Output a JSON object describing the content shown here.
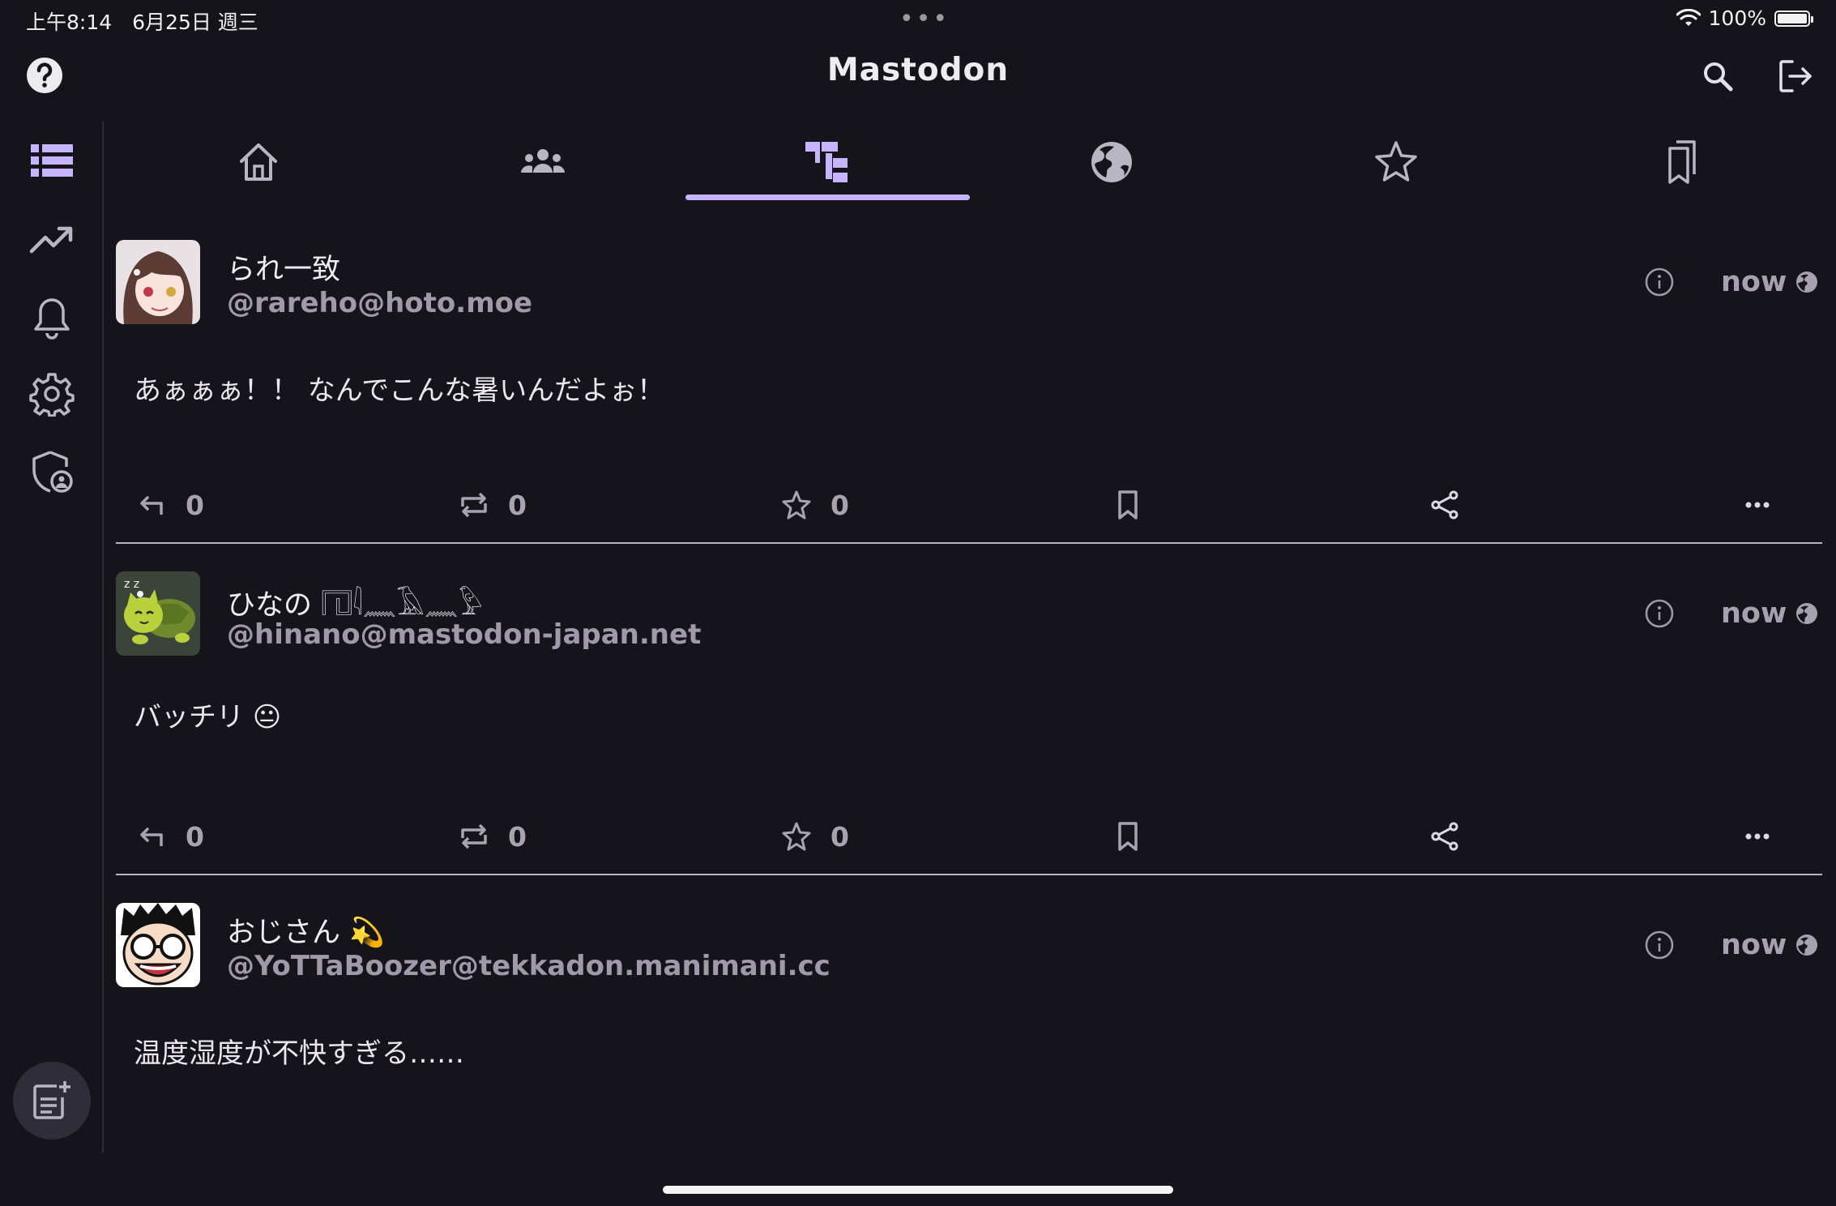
{
  "status_bar": {
    "time_date": "上午8:14　6月25日 週三",
    "dots": "•••",
    "battery_text": "100%"
  },
  "header": {
    "title": "Mastodon"
  },
  "tabs": [
    {
      "name": "home",
      "icon": "home-icon",
      "selected": false
    },
    {
      "name": "local",
      "icon": "people-icon",
      "selected": false
    },
    {
      "name": "federated-tree",
      "icon": "tree-icon",
      "selected": true
    },
    {
      "name": "public",
      "icon": "globe-icon",
      "selected": false
    },
    {
      "name": "favourites",
      "icon": "star-icon",
      "selected": false
    },
    {
      "name": "bookmarks",
      "icon": "bookmarks-icon",
      "selected": false
    }
  ],
  "side_rail": [
    "timeline-list-icon",
    "trending-icon",
    "bell-icon",
    "gear-icon",
    "shield-user-icon"
  ],
  "colors": {
    "background": "#15141a",
    "accent": "#c7b4ff",
    "muted_text": "#9e9aa9",
    "divider": "#b8b5c2"
  },
  "posts": [
    {
      "display_name": "られ一致",
      "handle": "@rareho@hoto.moe",
      "time": "now",
      "body": "あぁぁぁ！！ なんでこんな暑いんだよぉ！",
      "replies": "0",
      "boosts": "0",
      "favourites": "0"
    },
    {
      "display_name": "ひなの 𓉔𓇋𓈖𓄿𓈖𓅱",
      "handle": "@hinano@mastodon-japan.net",
      "time": "now",
      "body": "バッチリ 😐",
      "replies": "0",
      "boosts": "0",
      "favourites": "0"
    },
    {
      "display_name": "おじさん 💫",
      "handle": "@YoTTaBoozer@tekkadon.manimani.cc",
      "time": "now",
      "body": "温度湿度が不快すぎる……"
    }
  ]
}
